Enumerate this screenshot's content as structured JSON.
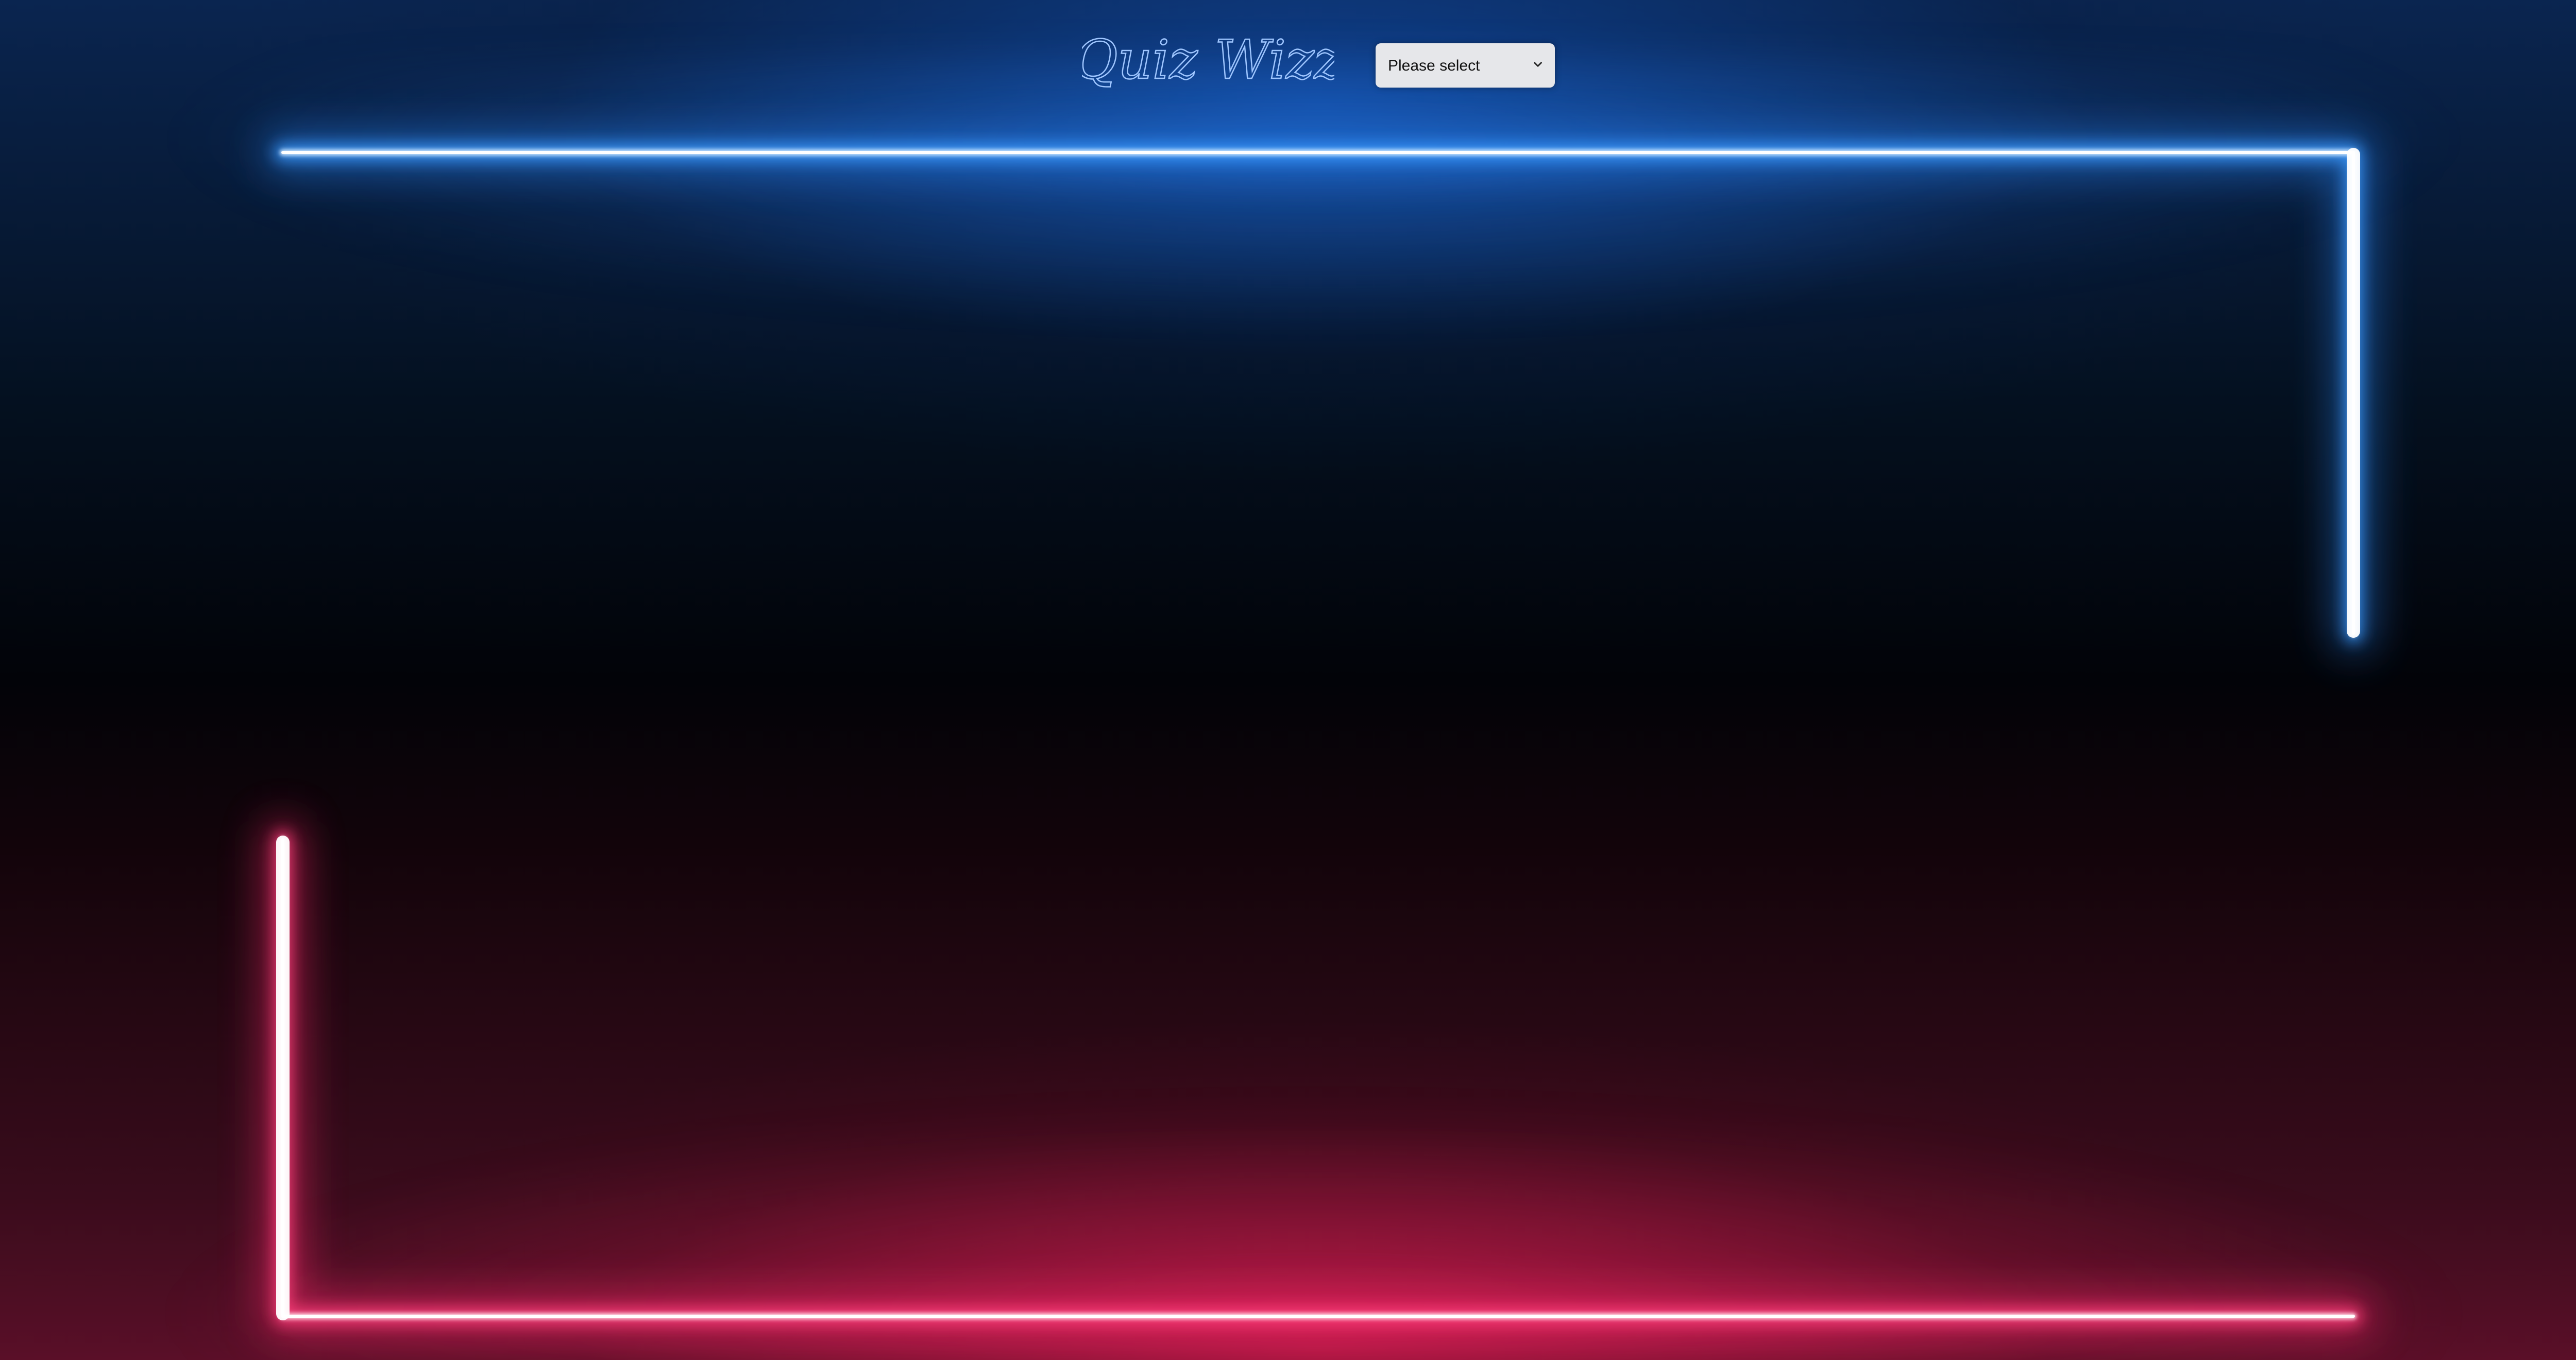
{
  "app": {
    "title": "Quiz Wizz"
  },
  "header": {
    "logo_text": "Quiz Wizz",
    "category_select": {
      "selected": "Please select",
      "options": [
        "Please select"
      ]
    }
  },
  "colors": {
    "neon_blue": "#2f8cff",
    "neon_blue_core": "#e8f4ff",
    "neon_red": "#ff2a6d",
    "neon_red_core": "#ffe6ee",
    "logo_stroke": "#9fc6ff",
    "background": "#03070d"
  },
  "icons": {
    "select_chevron": "chevron-down-icon"
  }
}
